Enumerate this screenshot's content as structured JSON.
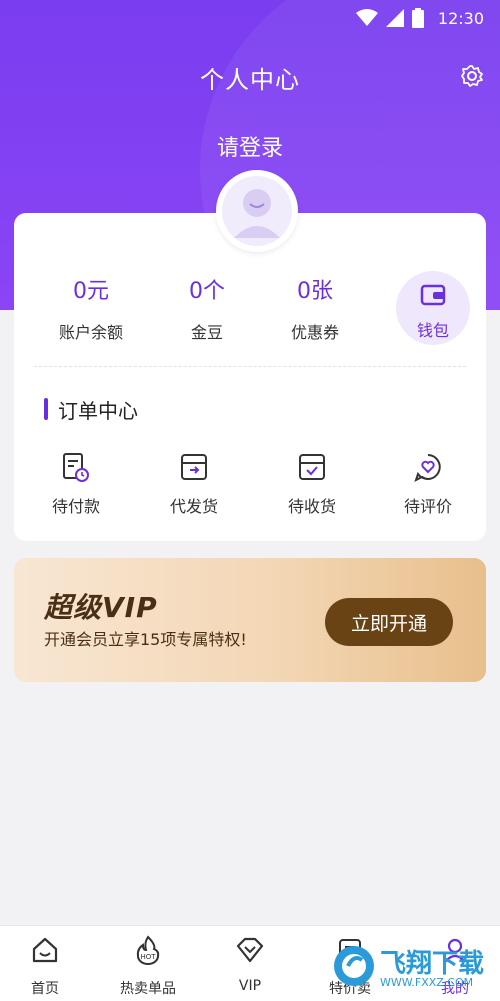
{
  "status_bar": {
    "time": "12:30"
  },
  "header": {
    "title": "个人中心",
    "login": "请登录"
  },
  "stats": [
    {
      "value": "0元",
      "label": "账户余额"
    },
    {
      "value": "0个",
      "label": "金豆"
    },
    {
      "value": "0张",
      "label": "优惠券"
    }
  ],
  "wallet": {
    "label": "钱包"
  },
  "orders": {
    "title": "订单中心",
    "items": [
      {
        "label": "待付款",
        "icon": "pending-payment-icon"
      },
      {
        "label": "代发货",
        "icon": "pending-shipment-icon"
      },
      {
        "label": "待收货",
        "icon": "pending-receipt-icon"
      },
      {
        "label": "待评价",
        "icon": "pending-review-icon"
      }
    ]
  },
  "vip": {
    "title": "超级VIP",
    "subtitle": "开通会员立享15项专属特权!",
    "button": "立即开通"
  },
  "tabs": [
    {
      "label": "首页",
      "icon": "home-icon"
    },
    {
      "label": "热卖单品",
      "icon": "hot-icon"
    },
    {
      "label": "VIP",
      "icon": "vip-diamond-icon"
    },
    {
      "label": "特价卖",
      "icon": "special-price-icon"
    },
    {
      "label": "我的",
      "icon": "profile-icon"
    }
  ],
  "watermark": {
    "text": "飞翔下载",
    "url": "WWW.FXXZ.COM"
  },
  "colors": {
    "primary": "#7a3df0",
    "accent": "#6b2fe0",
    "vip_button": "#6a4315"
  }
}
